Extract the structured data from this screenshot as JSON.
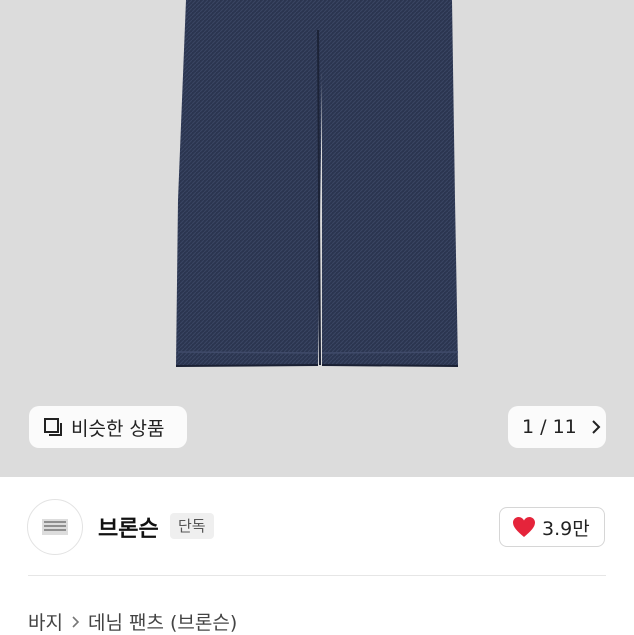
{
  "hero": {
    "similar_label": "비슷한 상품",
    "counter": "1 / 11",
    "icons": [
      "similar-items-icon",
      "chevron-right-icon"
    ]
  },
  "brand": {
    "name": "브론슨",
    "badge": "단독",
    "likes": "3.9만",
    "heart_color": "#e5243b"
  },
  "breadcrumb": {
    "category": "바지",
    "subcategory": "데님 팬츠 (브론슨)"
  }
}
